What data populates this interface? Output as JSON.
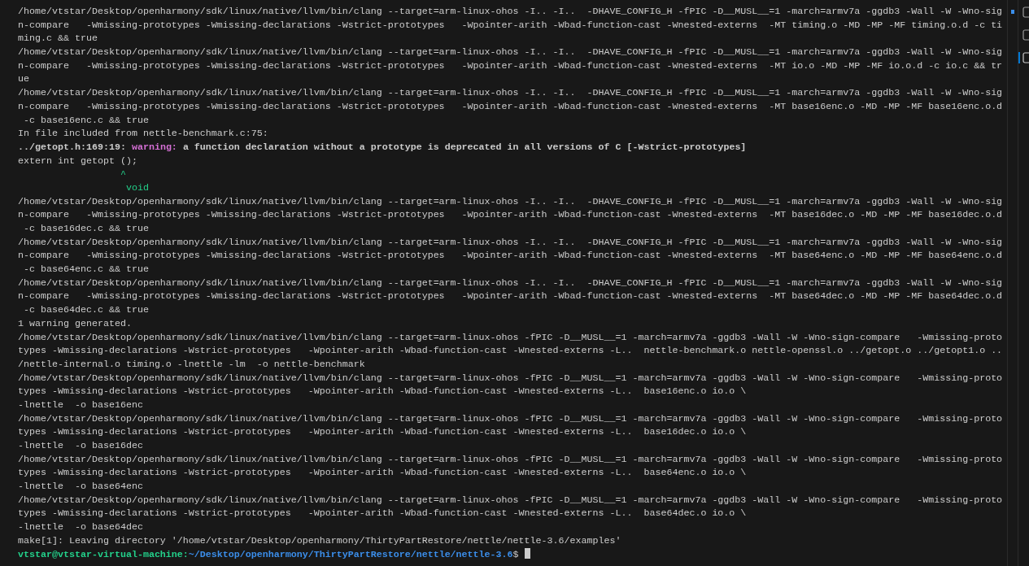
{
  "terminal": {
    "rows": [
      {
        "kind": "plain",
        "text": "/home/vtstar/Desktop/openharmony/sdk/linux/native/llvm/bin/clang --target=arm-linux-ohos -I.. -I..  -DHAVE_CONFIG_H -fPIC -D__MUSL__=1 -march=armv7a -ggdb3 -Wall -W -Wno-sig"
      },
      {
        "kind": "plain",
        "text": "n-compare   -Wmissing-prototypes -Wmissing-declarations -Wstrict-prototypes   -Wpointer-arith -Wbad-function-cast -Wnested-externs  -MT timing.o -MD -MP -MF timing.o.d -c ti"
      },
      {
        "kind": "plain",
        "text": "ming.c && true"
      },
      {
        "kind": "plain",
        "text": "/home/vtstar/Desktop/openharmony/sdk/linux/native/llvm/bin/clang --target=arm-linux-ohos -I.. -I..  -DHAVE_CONFIG_H -fPIC -D__MUSL__=1 -march=armv7a -ggdb3 -Wall -W -Wno-sig"
      },
      {
        "kind": "plain",
        "text": "n-compare   -Wmissing-prototypes -Wmissing-declarations -Wstrict-prototypes   -Wpointer-arith -Wbad-function-cast -Wnested-externs  -MT io.o -MD -MP -MF io.o.d -c io.c && tr"
      },
      {
        "kind": "plain",
        "text": "ue"
      },
      {
        "kind": "plain",
        "text": "/home/vtstar/Desktop/openharmony/sdk/linux/native/llvm/bin/clang --target=arm-linux-ohos -I.. -I..  -DHAVE_CONFIG_H -fPIC -D__MUSL__=1 -march=armv7a -ggdb3 -Wall -W -Wno-sig"
      },
      {
        "kind": "plain",
        "text": "n-compare   -Wmissing-prototypes -Wmissing-declarations -Wstrict-prototypes   -Wpointer-arith -Wbad-function-cast -Wnested-externs  -MT base16enc.o -MD -MP -MF base16enc.o.d"
      },
      {
        "kind": "plain",
        "text": " -c base16enc.c && true"
      },
      {
        "kind": "plain",
        "text": "In file included from nettle-benchmark.c:75:"
      },
      {
        "kind": "warning",
        "location": "../getopt.h:169:19:",
        "label": "warning:",
        "message": "a function declaration without a prototype is deprecated in all versions of C [-Wstrict-prototypes]"
      },
      {
        "kind": "plain",
        "text": "extern int getopt ();"
      },
      {
        "kind": "hint",
        "text": "                  ^"
      },
      {
        "kind": "hint",
        "text": "                   void"
      },
      {
        "kind": "plain",
        "text": "/home/vtstar/Desktop/openharmony/sdk/linux/native/llvm/bin/clang --target=arm-linux-ohos -I.. -I..  -DHAVE_CONFIG_H -fPIC -D__MUSL__=1 -march=armv7a -ggdb3 -Wall -W -Wno-sig"
      },
      {
        "kind": "plain",
        "text": "n-compare   -Wmissing-prototypes -Wmissing-declarations -Wstrict-prototypes   -Wpointer-arith -Wbad-function-cast -Wnested-externs  -MT base16dec.o -MD -MP -MF base16dec.o.d"
      },
      {
        "kind": "plain",
        "text": " -c base16dec.c && true"
      },
      {
        "kind": "plain",
        "text": "/home/vtstar/Desktop/openharmony/sdk/linux/native/llvm/bin/clang --target=arm-linux-ohos -I.. -I..  -DHAVE_CONFIG_H -fPIC -D__MUSL__=1 -march=armv7a -ggdb3 -Wall -W -Wno-sig"
      },
      {
        "kind": "plain",
        "text": "n-compare   -Wmissing-prototypes -Wmissing-declarations -Wstrict-prototypes   -Wpointer-arith -Wbad-function-cast -Wnested-externs  -MT base64enc.o -MD -MP -MF base64enc.o.d"
      },
      {
        "kind": "plain",
        "text": " -c base64enc.c && true"
      },
      {
        "kind": "plain",
        "text": "/home/vtstar/Desktop/openharmony/sdk/linux/native/llvm/bin/clang --target=arm-linux-ohos -I.. -I..  -DHAVE_CONFIG_H -fPIC -D__MUSL__=1 -march=armv7a -ggdb3 -Wall -W -Wno-sig"
      },
      {
        "kind": "plain",
        "text": "n-compare   -Wmissing-prototypes -Wmissing-declarations -Wstrict-prototypes   -Wpointer-arith -Wbad-function-cast -Wnested-externs  -MT base64dec.o -MD -MP -MF base64dec.o.d"
      },
      {
        "kind": "plain",
        "text": " -c base64dec.c && true"
      },
      {
        "kind": "plain",
        "text": "1 warning generated."
      },
      {
        "kind": "plain",
        "text": "/home/vtstar/Desktop/openharmony/sdk/linux/native/llvm/bin/clang --target=arm-linux-ohos -fPIC -D__MUSL__=1 -march=armv7a -ggdb3 -Wall -W -Wno-sign-compare   -Wmissing-proto"
      },
      {
        "kind": "plain",
        "text": "types -Wmissing-declarations -Wstrict-prototypes   -Wpointer-arith -Wbad-function-cast -Wnested-externs -L..  nettle-benchmark.o nettle-openssl.o ../getopt.o ../getopt1.o .."
      },
      {
        "kind": "plain",
        "text": "/nettle-internal.o timing.o -lnettle -lm  -o nettle-benchmark"
      },
      {
        "kind": "plain",
        "text": "/home/vtstar/Desktop/openharmony/sdk/linux/native/llvm/bin/clang --target=arm-linux-ohos -fPIC -D__MUSL__=1 -march=armv7a -ggdb3 -Wall -W -Wno-sign-compare   -Wmissing-proto"
      },
      {
        "kind": "plain",
        "text": "types -Wmissing-declarations -Wstrict-prototypes   -Wpointer-arith -Wbad-function-cast -Wnested-externs -L..  base16enc.o io.o \\"
      },
      {
        "kind": "plain",
        "text": "-lnettle  -o base16enc"
      },
      {
        "kind": "plain",
        "text": "/home/vtstar/Desktop/openharmony/sdk/linux/native/llvm/bin/clang --target=arm-linux-ohos -fPIC -D__MUSL__=1 -march=armv7a -ggdb3 -Wall -W -Wno-sign-compare   -Wmissing-proto"
      },
      {
        "kind": "plain",
        "text": "types -Wmissing-declarations -Wstrict-prototypes   -Wpointer-arith -Wbad-function-cast -Wnested-externs -L..  base16dec.o io.o \\"
      },
      {
        "kind": "plain",
        "text": "-lnettle  -o base16dec"
      },
      {
        "kind": "plain",
        "text": "/home/vtstar/Desktop/openharmony/sdk/linux/native/llvm/bin/clang --target=arm-linux-ohos -fPIC -D__MUSL__=1 -march=armv7a -ggdb3 -Wall -W -Wno-sign-compare   -Wmissing-proto"
      },
      {
        "kind": "plain",
        "text": "types -Wmissing-declarations -Wstrict-prototypes   -Wpointer-arith -Wbad-function-cast -Wnested-externs -L..  base64enc.o io.o \\"
      },
      {
        "kind": "plain",
        "text": "-lnettle  -o base64enc"
      },
      {
        "kind": "plain",
        "text": "/home/vtstar/Desktop/openharmony/sdk/linux/native/llvm/bin/clang --target=arm-linux-ohos -fPIC -D__MUSL__=1 -march=armv7a -ggdb3 -Wall -W -Wno-sign-compare   -Wmissing-proto"
      },
      {
        "kind": "plain",
        "text": "types -Wmissing-declarations -Wstrict-prototypes   -Wpointer-arith -Wbad-function-cast -Wnested-externs -L..  base64dec.o io.o \\"
      },
      {
        "kind": "plain",
        "text": "-lnettle  -o base64dec"
      },
      {
        "kind": "plain",
        "text": "make[1]: Leaving directory '/home/vtstar/Desktop/openharmony/ThirtyPartRestore/nettle/nettle-3.6/examples'"
      },
      {
        "kind": "prompt",
        "user": "vtstar@vtstar-virtual-machine:",
        "path": "~/Desktop/openharmony/ThirtyPartRestore/nettle/nettle-3.6",
        "symbol": "$ "
      }
    ]
  }
}
